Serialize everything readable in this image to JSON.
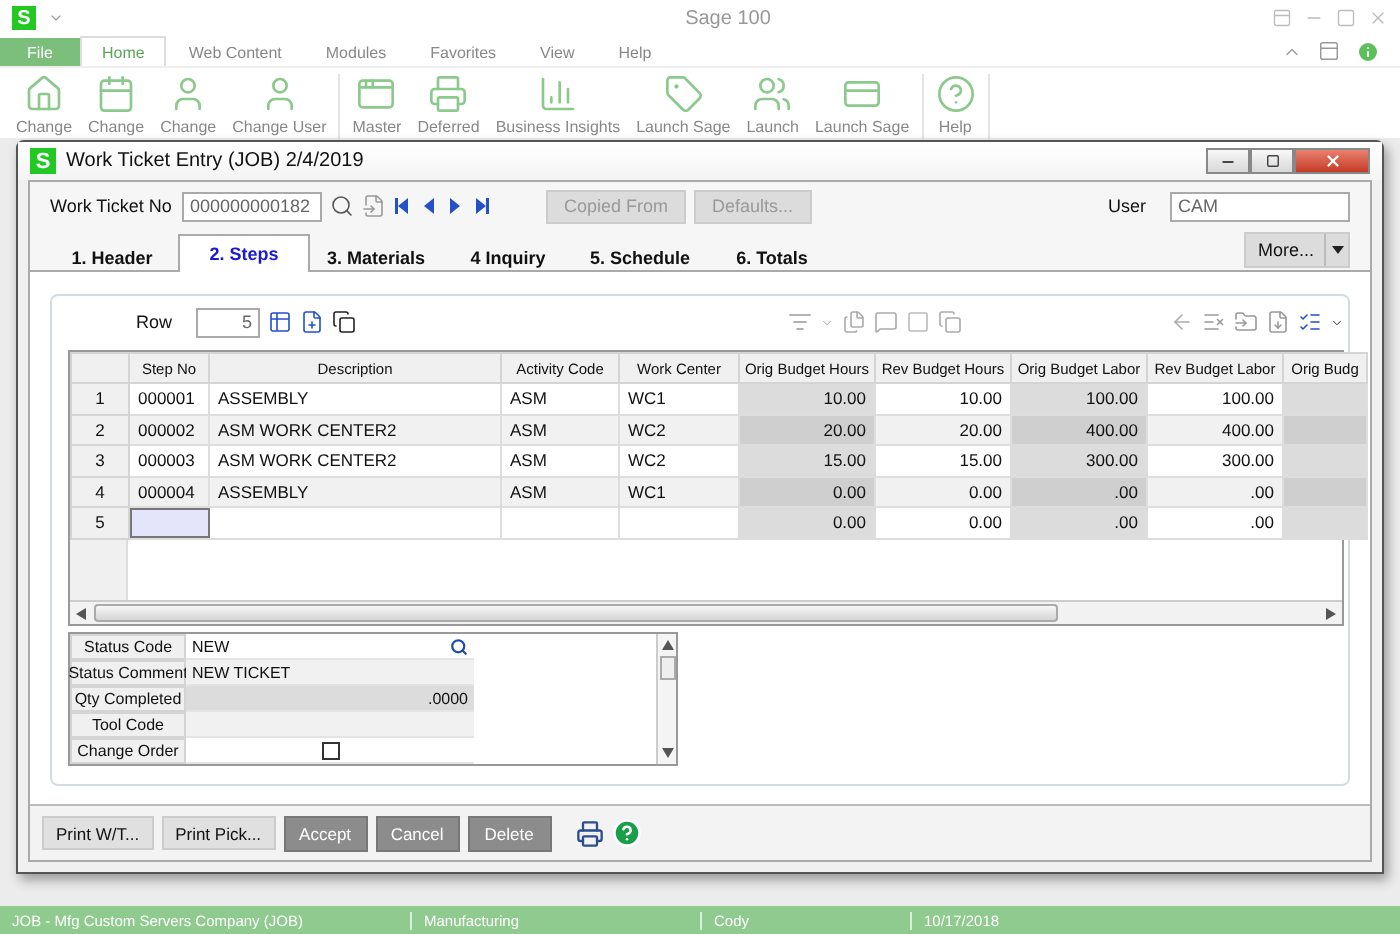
{
  "app": {
    "logo": "S",
    "title": "Sage 100"
  },
  "file_button": "File",
  "ribbon_tabs": [
    {
      "label": "Home",
      "selected": true
    },
    {
      "label": "Web Content",
      "selected": false
    },
    {
      "label": "Modules",
      "selected": false
    },
    {
      "label": "Favorites",
      "selected": false
    },
    {
      "label": "View",
      "selected": false
    },
    {
      "label": "Help",
      "selected": false
    }
  ],
  "ribbon": {
    "groups": [
      {
        "items": [
          {
            "label": "Change"
          },
          {
            "label": "Change"
          },
          {
            "label": "Change"
          },
          {
            "label": "Change User"
          }
        ]
      },
      {
        "items": [
          {
            "label": "Master"
          },
          {
            "label": "Deferred"
          },
          {
            "label": "Business Insights"
          },
          {
            "label": "Launch Sage"
          },
          {
            "label": "Launch"
          },
          {
            "label": "Launch Sage"
          }
        ]
      },
      {
        "items": [
          {
            "label": "Help"
          }
        ]
      }
    ]
  },
  "dialog": {
    "logo": "S",
    "title": "Work Ticket Entry (JOB) 2/4/2019",
    "work_ticket_label": "Work Ticket No",
    "work_ticket_no": "000000000182",
    "buttons": [
      {
        "label": "Copied From",
        "disabled": true
      },
      {
        "label": "Defaults...",
        "disabled": true
      }
    ],
    "user_label": "User",
    "user": "CAM",
    "tabs": [
      {
        "label": "1. Header",
        "selected": false
      },
      {
        "label": "2. Steps",
        "selected": true
      },
      {
        "label": "3. Materials",
        "selected": false
      },
      {
        "label": "4 Inquiry",
        "selected": false
      },
      {
        "label": "5. Schedule",
        "selected": false
      },
      {
        "label": "6. Totals",
        "selected": false
      }
    ],
    "more_button": "More...",
    "row_label": "Row",
    "row_value": "5",
    "grid": {
      "columns": [
        {
          "label": "Step No",
          "kind": "text",
          "shaded": false
        },
        {
          "label": "Description",
          "kind": "text",
          "shaded": false
        },
        {
          "label": "Activity Code",
          "kind": "text",
          "shaded": false
        },
        {
          "label": "Work Center",
          "kind": "text",
          "shaded": false
        },
        {
          "label": "Orig Budget Hours",
          "kind": "number",
          "shaded": true
        },
        {
          "label": "Rev Budget Hours",
          "kind": "number",
          "shaded": false
        },
        {
          "label": "Orig Budget Labor",
          "kind": "number",
          "shaded": true
        },
        {
          "label": "Rev Budget Labor",
          "kind": "number",
          "shaded": false
        },
        {
          "label": "Orig Budg",
          "kind": "number",
          "shaded": true
        }
      ],
      "rows": [
        {
          "number": "1",
          "selected": false,
          "cells": [
            "000001",
            "ASSEMBLY",
            "ASM",
            "WC1",
            "10.00",
            "10.00",
            "100.00",
            "100.00"
          ]
        },
        {
          "number": "2",
          "selected": false,
          "cells": [
            "000002",
            "ASM WORK CENTER2",
            "ASM",
            "WC2",
            "20.00",
            "20.00",
            "400.00",
            "400.00"
          ]
        },
        {
          "number": "3",
          "selected": false,
          "cells": [
            "000003",
            "ASM WORK CENTER2",
            "ASM",
            "WC2",
            "15.00",
            "15.00",
            "300.00",
            "300.00"
          ]
        },
        {
          "number": "4",
          "selected": false,
          "cells": [
            "000004",
            "ASSEMBLY",
            "ASM",
            "WC1",
            "0.00",
            "0.00",
            ".00",
            ".00"
          ]
        },
        {
          "number": "5",
          "selected": true,
          "cells": [
            null,
            null,
            null,
            null,
            "0.00",
            "0.00",
            ".00",
            ".00"
          ]
        }
      ]
    },
    "details": [
      {
        "label": "Status Code",
        "value": "NEW",
        "kind": "lookup"
      },
      {
        "label": "Status Comment",
        "value": "NEW TICKET",
        "kind": "text"
      },
      {
        "label": "Qty Completed",
        "value": ".0000",
        "kind": "number"
      },
      {
        "label": "Tool Code",
        "kind": "text"
      },
      {
        "label": "Change Order",
        "kind": "checkbox",
        "checked": false
      }
    ],
    "left_buttons": [
      "Print W/T...",
      "Print Pick..."
    ],
    "right_buttons": [
      "Accept",
      "Cancel",
      "Delete"
    ]
  },
  "status_bar": [
    "JOB - Mfg Custom Servers Company (JOB)",
    "Manufacturing",
    "Cody",
    "10/17/2018"
  ]
}
